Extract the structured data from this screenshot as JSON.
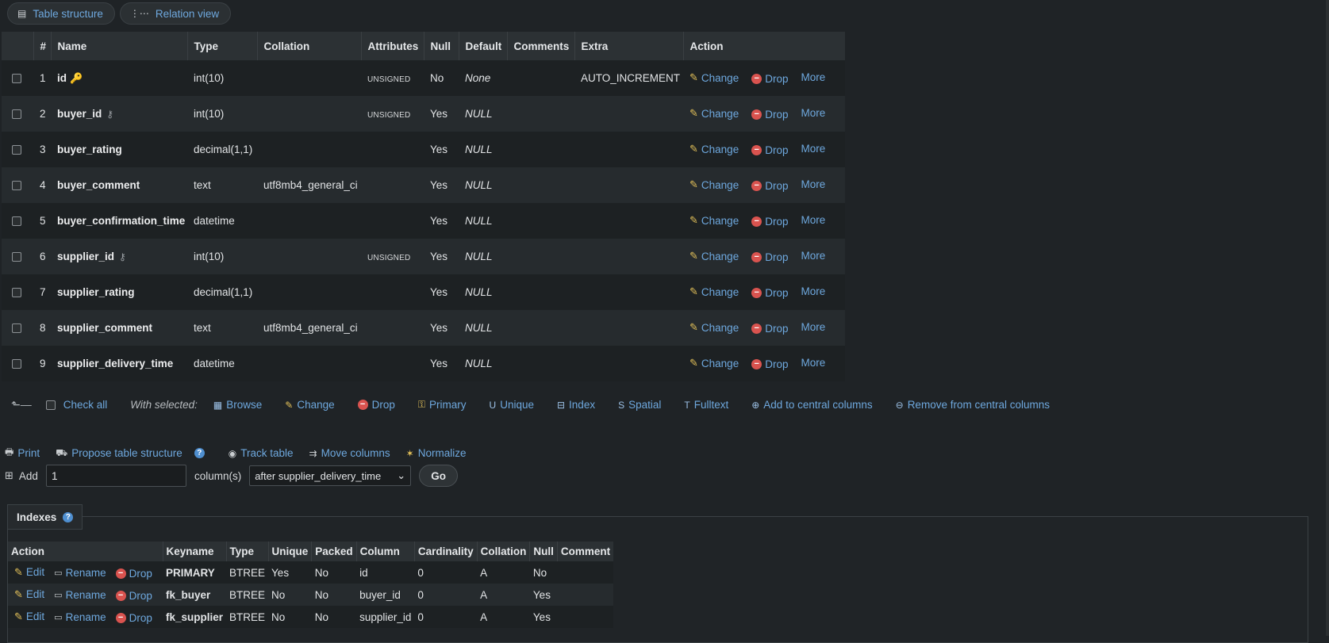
{
  "tabs": [
    {
      "label": "Table structure",
      "icon": "table-structure-icon"
    },
    {
      "label": "Relation view",
      "icon": "relation-icon"
    }
  ],
  "structure": {
    "headers": [
      "#",
      "Name",
      "Type",
      "Collation",
      "Attributes",
      "Null",
      "Default",
      "Comments",
      "Extra",
      "Action"
    ],
    "action_labels": {
      "change": "Change",
      "drop": "Drop",
      "more": "More"
    },
    "rows": [
      {
        "num": "1",
        "name": "id",
        "key": "primary",
        "type": "int(10)",
        "collation": "",
        "attributes": "UNSIGNED",
        "null": "No",
        "default": "None",
        "comments": "",
        "extra": "AUTO_INCREMENT"
      },
      {
        "num": "2",
        "name": "buyer_id",
        "key": "foreign",
        "type": "int(10)",
        "collation": "",
        "attributes": "UNSIGNED",
        "null": "Yes",
        "default": "NULL",
        "comments": "",
        "extra": ""
      },
      {
        "num": "3",
        "name": "buyer_rating",
        "key": "",
        "type": "decimal(1,1)",
        "collation": "",
        "attributes": "",
        "null": "Yes",
        "default": "NULL",
        "comments": "",
        "extra": ""
      },
      {
        "num": "4",
        "name": "buyer_comment",
        "key": "",
        "type": "text",
        "collation": "utf8mb4_general_ci",
        "attributes": "",
        "null": "Yes",
        "default": "NULL",
        "comments": "",
        "extra": ""
      },
      {
        "num": "5",
        "name": "buyer_confirmation_time",
        "key": "",
        "type": "datetime",
        "collation": "",
        "attributes": "",
        "null": "Yes",
        "default": "NULL",
        "comments": "",
        "extra": ""
      },
      {
        "num": "6",
        "name": "supplier_id",
        "key": "foreign",
        "type": "int(10)",
        "collation": "",
        "attributes": "UNSIGNED",
        "null": "Yes",
        "default": "NULL",
        "comments": "",
        "extra": ""
      },
      {
        "num": "7",
        "name": "supplier_rating",
        "key": "",
        "type": "decimal(1,1)",
        "collation": "",
        "attributes": "",
        "null": "Yes",
        "default": "NULL",
        "comments": "",
        "extra": ""
      },
      {
        "num": "8",
        "name": "supplier_comment",
        "key": "",
        "type": "text",
        "collation": "utf8mb4_general_ci",
        "attributes": "",
        "null": "Yes",
        "default": "NULL",
        "comments": "",
        "extra": ""
      },
      {
        "num": "9",
        "name": "supplier_delivery_time",
        "key": "",
        "type": "datetime",
        "collation": "",
        "attributes": "",
        "null": "Yes",
        "default": "NULL",
        "comments": "",
        "extra": ""
      }
    ]
  },
  "with_selected": {
    "check_all": "Check all",
    "label": "With selected:",
    "actions": [
      {
        "label": "Browse",
        "icon": "browse-icon"
      },
      {
        "label": "Change",
        "icon": "pencil-icon"
      },
      {
        "label": "Drop",
        "icon": "drop-icon"
      },
      {
        "label": "Primary",
        "icon": "key-icon"
      },
      {
        "label": "Unique",
        "icon": "unique-icon"
      },
      {
        "label": "Index",
        "icon": "index-icon"
      },
      {
        "label": "Spatial",
        "icon": "spatial-icon"
      },
      {
        "label": "Fulltext",
        "icon": "fulltext-icon"
      },
      {
        "label": "Add to central columns",
        "icon": "add-central-icon"
      },
      {
        "label": "Remove from central columns",
        "icon": "remove-central-icon"
      }
    ]
  },
  "tools": [
    {
      "label": "Print",
      "icon": "print-icon"
    },
    {
      "label": "Propose table structure",
      "icon": "propose-icon"
    },
    {
      "label": "Track table",
      "icon": "eye-icon"
    },
    {
      "label": "Move columns",
      "icon": "move-columns-icon"
    },
    {
      "label": "Normalize",
      "icon": "wand-icon"
    }
  ],
  "add_columns": {
    "label": "Add",
    "value": "1",
    "unit": "column(s)",
    "position": "after supplier_delivery_time",
    "go": "Go"
  },
  "indexes": {
    "title": "Indexes",
    "headers": [
      "Action",
      "Keyname",
      "Type",
      "Unique",
      "Packed",
      "Column",
      "Cardinality",
      "Collation",
      "Null",
      "Comment"
    ],
    "action_labels": {
      "edit": "Edit",
      "rename": "Rename",
      "drop": "Drop"
    },
    "rows": [
      {
        "keyname": "PRIMARY",
        "type": "BTREE",
        "unique": "Yes",
        "packed": "No",
        "column": "id",
        "cardinality": "0",
        "collation": "A",
        "null": "No",
        "comment": ""
      },
      {
        "keyname": "fk_buyer",
        "type": "BTREE",
        "unique": "No",
        "packed": "No",
        "column": "buyer_id",
        "cardinality": "0",
        "collation": "A",
        "null": "Yes",
        "comment": ""
      },
      {
        "keyname": "fk_supplier",
        "type": "BTREE",
        "unique": "No",
        "packed": "No",
        "column": "supplier_id",
        "cardinality": "0",
        "collation": "A",
        "null": "Yes",
        "comment": ""
      }
    ]
  }
}
